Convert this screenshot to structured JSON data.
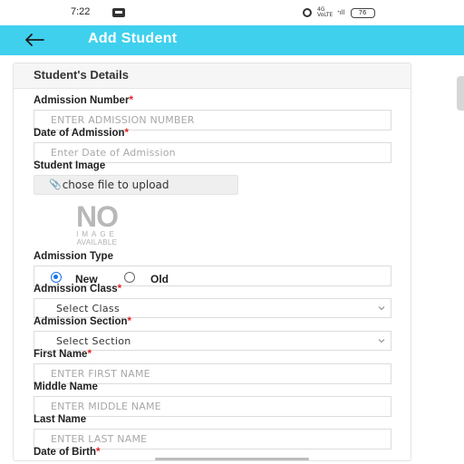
{
  "status_bar": {
    "time": "7:22",
    "network": "4G\nVoLTE",
    "signal": "ᐩıll",
    "battery": "76"
  },
  "app_bar": {
    "title": "Add Student",
    "background_color": "#3fd0ee"
  },
  "form": {
    "section_title": "Student's Details",
    "admission_number": {
      "label": "Admission Number",
      "required": "*",
      "placeholder": "ENTER ADMISSION NUMBER"
    },
    "date_of_admission": {
      "label": "Date of Admission",
      "required": "*",
      "placeholder": "Enter Date of Admission"
    },
    "student_image": {
      "label": "Student Image",
      "upload_label": "chose file to upload",
      "no_image_big": "NO",
      "no_image_line1": "IMAGE",
      "no_image_line2": "AVAILABLE"
    },
    "admission_type": {
      "label": "Admission Type",
      "options": [
        "New",
        "Old"
      ],
      "selected": "New"
    },
    "admission_class": {
      "label": "Admission Class",
      "required": "*",
      "value": "Select Class"
    },
    "admission_section": {
      "label": "Admission Section",
      "required": "*",
      "value": "Select Section"
    },
    "first_name": {
      "label": "First Name",
      "required": "*",
      "placeholder": "ENTER FIRST NAME"
    },
    "middle_name": {
      "label": "Middle Name",
      "placeholder": "ENTER MIDDLE NAME"
    },
    "last_name": {
      "label": "Last Name",
      "placeholder": "ENTER LAST NAME"
    },
    "date_of_birth": {
      "label": "Date of Birth",
      "required": "*"
    }
  },
  "colors": {
    "accent": "#3fd0ee",
    "required": "#e02020",
    "radio_selected": "#1a73e8"
  }
}
